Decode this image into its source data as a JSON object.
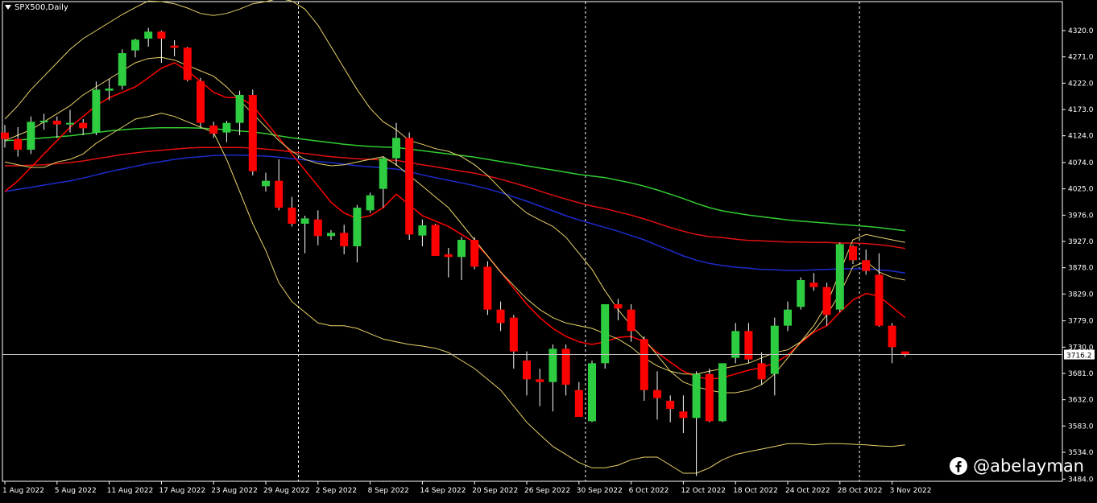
{
  "header": {
    "symbol": "SPX500,Daily"
  },
  "watermark": {
    "handle": "@abelayman",
    "icon": "facebook-icon"
  },
  "price_tag": "3716.2",
  "colors": {
    "background": "#000000",
    "bull": "#2ecc40",
    "bear": "#ff0000",
    "ma_fast": "#ff0000",
    "ma_slow_red": "#e01010",
    "ma_green": "#32cd32",
    "ma_blue": "#1c2ccc",
    "bollinger": "#e8d26a",
    "axis_text": "#ffffff",
    "price_line": "#c0c0c0"
  },
  "chart_data": {
    "type": "candlestick",
    "title": "SPX500,Daily",
    "y_ticks": [
      4320.0,
      4271.0,
      4222.0,
      4173.0,
      4124.0,
      4074.0,
      4025.0,
      3976.0,
      3927.0,
      3878.0,
      3829.0,
      3779.0,
      3730.0,
      3681.0,
      3632.0,
      3583.0,
      3534.0,
      3484.0
    ],
    "ylim": [
      3480,
      4374
    ],
    "x_tick_labels": [
      "1 Aug 2022",
      "5 Aug 2022",
      "11 Aug 2022",
      "17 Aug 2022",
      "23 Aug 2022",
      "29 Aug 2022",
      "2 Sep 2022",
      "8 Sep 2022",
      "14 Sep 2022",
      "20 Sep 2022",
      "26 Sep 2022",
      "30 Sep 2022",
      "6 Oct 2022",
      "12 Oct 2022",
      "18 Oct 2022",
      "24 Oct 2022",
      "28 Oct 2022",
      "3 Nov 2022"
    ],
    "x_tick_bar_index": [
      0,
      4,
      8,
      12,
      16,
      20,
      24,
      28,
      32,
      36,
      40,
      44,
      48,
      52,
      56,
      60,
      64,
      68
    ],
    "period_separators_bar_index": [
      22.5,
      44.5,
      65.5
    ],
    "last_price": 3716.2,
    "candles": [
      {
        "o": 4130,
        "h": 4144,
        "l": 4102,
        "c": 4118
      },
      {
        "o": 4118,
        "h": 4140,
        "l": 4085,
        "c": 4098
      },
      {
        "o": 4098,
        "h": 4160,
        "l": 4090,
        "c": 4150
      },
      {
        "o": 4150,
        "h": 4165,
        "l": 4135,
        "c": 4152
      },
      {
        "o": 4152,
        "h": 4160,
        "l": 4120,
        "c": 4145
      },
      {
        "o": 4145,
        "h": 4172,
        "l": 4130,
        "c": 4148
      },
      {
        "o": 4148,
        "h": 4155,
        "l": 4125,
        "c": 4138
      },
      {
        "o": 4130,
        "h": 4225,
        "l": 4125,
        "c": 4210
      },
      {
        "o": 4208,
        "h": 4230,
        "l": 4190,
        "c": 4212
      },
      {
        "o": 4217,
        "h": 4285,
        "l": 4210,
        "c": 4278
      },
      {
        "o": 4283,
        "h": 4305,
        "l": 4270,
        "c": 4303
      },
      {
        "o": 4305,
        "h": 4325,
        "l": 4290,
        "c": 4318
      },
      {
        "o": 4318,
        "h": 4320,
        "l": 4260,
        "c": 4305
      },
      {
        "o": 4292,
        "h": 4302,
        "l": 4272,
        "c": 4288
      },
      {
        "o": 4288,
        "h": 4290,
        "l": 4225,
        "c": 4228
      },
      {
        "o": 4226,
        "h": 4232,
        "l": 4140,
        "c": 4148
      },
      {
        "o": 4143,
        "h": 4150,
        "l": 4120,
        "c": 4128
      },
      {
        "o": 4130,
        "h": 4152,
        "l": 4112,
        "c": 4148
      },
      {
        "o": 4148,
        "h": 4208,
        "l": 4125,
        "c": 4200
      },
      {
        "o": 4200,
        "h": 4210,
        "l": 4050,
        "c": 4058
      },
      {
        "o": 4030,
        "h": 4055,
        "l": 4020,
        "c": 4040
      },
      {
        "o": 4040,
        "h": 4080,
        "l": 3985,
        "c": 3990
      },
      {
        "o": 3990,
        "h": 4010,
        "l": 3955,
        "c": 3960
      },
      {
        "o": 3960,
        "h": 3975,
        "l": 3905,
        "c": 3970
      },
      {
        "o": 3968,
        "h": 3985,
        "l": 3920,
        "c": 3937
      },
      {
        "o": 3937,
        "h": 3948,
        "l": 3930,
        "c": 3943
      },
      {
        "o": 3943,
        "h": 3958,
        "l": 3903,
        "c": 3918
      },
      {
        "o": 3918,
        "h": 3995,
        "l": 3888,
        "c": 3990
      },
      {
        "o": 3985,
        "h": 4018,
        "l": 3980,
        "c": 4013
      },
      {
        "o": 4025,
        "h": 4085,
        "l": 3990,
        "c": 4082
      },
      {
        "o": 4082,
        "h": 4148,
        "l": 4068,
        "c": 4120
      },
      {
        "o": 4120,
        "h": 4130,
        "l": 3930,
        "c": 3940
      },
      {
        "o": 3938,
        "h": 3968,
        "l": 3918,
        "c": 3957
      },
      {
        "o": 3958,
        "h": 3960,
        "l": 3905,
        "c": 3900
      },
      {
        "o": 3903,
        "h": 3915,
        "l": 3860,
        "c": 3898
      },
      {
        "o": 3898,
        "h": 3935,
        "l": 3855,
        "c": 3930
      },
      {
        "o": 3930,
        "h": 3935,
        "l": 3875,
        "c": 3880
      },
      {
        "o": 3880,
        "h": 3890,
        "l": 3790,
        "c": 3800
      },
      {
        "o": 3800,
        "h": 3815,
        "l": 3760,
        "c": 3775
      },
      {
        "o": 3785,
        "h": 3790,
        "l": 3690,
        "c": 3722
      },
      {
        "o": 3705,
        "h": 3722,
        "l": 3640,
        "c": 3670
      },
      {
        "o": 3670,
        "h": 3690,
        "l": 3620,
        "c": 3665
      },
      {
        "o": 3665,
        "h": 3735,
        "l": 3610,
        "c": 3727
      },
      {
        "o": 3727,
        "h": 3735,
        "l": 3640,
        "c": 3660
      },
      {
        "o": 3650,
        "h": 3665,
        "l": 3600,
        "c": 3600
      },
      {
        "o": 3592,
        "h": 3705,
        "l": 3590,
        "c": 3700
      },
      {
        "o": 3700,
        "h": 3810,
        "l": 3690,
        "c": 3810
      },
      {
        "o": 3810,
        "h": 3820,
        "l": 3780,
        "c": 3802
      },
      {
        "o": 3800,
        "h": 3810,
        "l": 3740,
        "c": 3760
      },
      {
        "o": 3745,
        "h": 3750,
        "l": 3630,
        "c": 3650
      },
      {
        "o": 3650,
        "h": 3685,
        "l": 3595,
        "c": 3635
      },
      {
        "o": 3630,
        "h": 3640,
        "l": 3590,
        "c": 3615
      },
      {
        "o": 3610,
        "h": 3640,
        "l": 3570,
        "c": 3598
      },
      {
        "o": 3598,
        "h": 3685,
        "l": 3490,
        "c": 3680
      },
      {
        "o": 3680,
        "h": 3690,
        "l": 3590,
        "c": 3592
      },
      {
        "o": 3592,
        "h": 3700,
        "l": 3590,
        "c": 3700
      },
      {
        "o": 3710,
        "h": 3775,
        "l": 3700,
        "c": 3760
      },
      {
        "o": 3760,
        "h": 3775,
        "l": 3700,
        "c": 3707
      },
      {
        "o": 3700,
        "h": 3720,
        "l": 3660,
        "c": 3670
      },
      {
        "o": 3680,
        "h": 3785,
        "l": 3640,
        "c": 3770
      },
      {
        "o": 3770,
        "h": 3815,
        "l": 3760,
        "c": 3800
      },
      {
        "o": 3805,
        "h": 3860,
        "l": 3800,
        "c": 3855
      },
      {
        "o": 3850,
        "h": 3868,
        "l": 3835,
        "c": 3842
      },
      {
        "o": 3842,
        "h": 3850,
        "l": 3770,
        "c": 3790
      },
      {
        "o": 3800,
        "h": 3925,
        "l": 3795,
        "c": 3922
      },
      {
        "o": 3918,
        "h": 3920,
        "l": 3885,
        "c": 3892
      },
      {
        "o": 3892,
        "h": 3912,
        "l": 3865,
        "c": 3872
      },
      {
        "o": 3865,
        "h": 3905,
        "l": 3768,
        "c": 3770
      },
      {
        "o": 3770,
        "h": 3775,
        "l": 3700,
        "c": 3730
      },
      {
        "o": 3722,
        "h": 3722,
        "l": 3712,
        "c": 3716
      }
    ],
    "moving_averages": [
      {
        "color": "#32cd32",
        "values": [
          4115,
          4116,
          4118,
          4120,
          4122,
          4124,
          4127,
          4130,
          4133,
          4135,
          4137,
          4138,
          4139,
          4139,
          4139,
          4138,
          4137,
          4135,
          4133,
          4131,
          4128,
          4124,
          4120,
          4117,
          4114,
          4111,
          4108,
          4106,
          4104,
          4103,
          4102,
          4099,
          4096,
          4093,
          4090,
          4087,
          4084,
          4080,
          4076,
          4072,
          4068,
          4064,
          4060,
          4056,
          4052,
          4049,
          4046,
          4041,
          4036,
          4030,
          4023,
          4015,
          4007,
          3998,
          3990,
          3984,
          3980,
          3976,
          3973,
          3970,
          3967,
          3965,
          3963,
          3961,
          3959,
          3957,
          3955,
          3953,
          3950,
          3947
        ]
      },
      {
        "color": "#e01010",
        "values": [
          4068,
          4068,
          4069,
          4070,
          4072,
          4074,
          4077,
          4081,
          4085,
          4089,
          4092,
          4095,
          4097,
          4099,
          4101,
          4102,
          4102,
          4102,
          4102,
          4101,
          4099,
          4097,
          4094,
          4091,
          4088,
          4085,
          4083,
          4081,
          4080,
          4079,
          4078,
          4074,
          4070,
          4066,
          4062,
          4058,
          4054,
          4049,
          4043,
          4036,
          4029,
          4021,
          4013,
          4006,
          3999,
          3993,
          3988,
          3982,
          3976,
          3969,
          3961,
          3953,
          3946,
          3940,
          3936,
          3934,
          3931,
          3929,
          3928,
          3927,
          3926,
          3926,
          3925,
          3925,
          3924,
          3924,
          3923,
          3921,
          3918,
          3914
        ]
      },
      {
        "color": "#1c2ccc",
        "values": [
          4020,
          4024,
          4028,
          4032,
          4036,
          4040,
          4045,
          4051,
          4057,
          4062,
          4067,
          4072,
          4076,
          4080,
          4083,
          4085,
          4087,
          4088,
          4088,
          4087,
          4086,
          4084,
          4081,
          4079,
          4076,
          4074,
          4071,
          4068,
          4066,
          4064,
          4062,
          4057,
          4051,
          4046,
          4041,
          4036,
          4031,
          4025,
          4018,
          4010,
          4002,
          3993,
          3984,
          3975,
          3967,
          3960,
          3953,
          3946,
          3938,
          3930,
          3920,
          3910,
          3900,
          3892,
          3886,
          3882,
          3879,
          3877,
          3875,
          3874,
          3873,
          3873,
          3874,
          3875,
          3876,
          3876,
          3876,
          3874,
          3872,
          3868
        ]
      },
      {
        "color": "#ff0000",
        "values": [
          4020,
          4040,
          4065,
          4090,
          4115,
          4140,
          4160,
          4180,
          4195,
          4205,
          4215,
          4232,
          4250,
          4260,
          4245,
          4225,
          4205,
          4195,
          4195,
          4180,
          4150,
          4120,
          4090,
          4060,
          4030,
          4000,
          3980,
          3970,
          3975,
          3990,
          4015,
          3995,
          3975,
          3965,
          3955,
          3940,
          3925,
          3900,
          3870,
          3840,
          3810,
          3785,
          3765,
          3750,
          3740,
          3735,
          3740,
          3748,
          3750,
          3740,
          3720,
          3702,
          3685,
          3675,
          3670,
          3673,
          3680,
          3687,
          3692,
          3700,
          3715,
          3738,
          3758,
          3770,
          3795,
          3818,
          3830,
          3825,
          3805,
          3785
        ]
      },
      {
        "color": "#e8d26a",
        "values": [
          4115,
          4125,
          4135,
          4150,
          4165,
          4180,
          4200,
          4215,
          4230,
          4245,
          4260,
          4268,
          4270,
          4265,
          4255,
          4245,
          4235,
          4215,
          4190,
          4165,
          4140,
          4115,
          4095,
          4080,
          4072,
          4068,
          4070,
          4075,
          4080,
          4085,
          4070,
          4050,
          4030,
          4010,
          3990,
          3960,
          3930,
          3900,
          3870,
          3845,
          3820,
          3800,
          3785,
          3775,
          3770,
          3765,
          3755,
          3745,
          3730,
          3710,
          3695,
          3685,
          3680,
          3680,
          3685,
          3690,
          3695,
          3700,
          3710,
          3720,
          3725,
          3740,
          3760,
          3790,
          3830,
          3880,
          3890,
          3870,
          3860,
          3855
        ]
      },
      {
        "color": "#e8d26a",
        "values": [
          4155,
          4180,
          4210,
          4235,
          4260,
          4285,
          4305,
          4320,
          4335,
          4350,
          4363,
          4375,
          4374,
          4370,
          4362,
          4352,
          4348,
          4352,
          4360,
          4370,
          4374,
          4380,
          4375,
          4360,
          4330,
          4290,
          4250,
          4210,
          4175,
          4150,
          4135,
          4115,
          4108,
          4100,
          4095,
          4085,
          4070,
          4050,
          4025,
          4000,
          3980,
          3967,
          3955,
          3935,
          3905,
          3875,
          3835,
          3800,
          3770,
          3745,
          3715,
          3685,
          3665,
          3656,
          3650,
          3645,
          3645,
          3650,
          3660,
          3680,
          3710,
          3740,
          3770,
          3810,
          3870,
          3930,
          3940,
          3935,
          3930,
          3925
        ]
      },
      {
        "color": "#e8d26a",
        "values": [
          4075,
          4070,
          4065,
          4065,
          4075,
          4080,
          4090,
          4110,
          4125,
          4140,
          4155,
          4160,
          4166,
          4160,
          4150,
          4140,
          4130,
          4080,
          4020,
          3960,
          3910,
          3850,
          3815,
          3795,
          3775,
          3770,
          3770,
          3765,
          3755,
          3745,
          3740,
          3735,
          3732,
          3728,
          3720,
          3705,
          3690,
          3670,
          3650,
          3620,
          3590,
          3567,
          3545,
          3530,
          3515,
          3505,
          3505,
          3510,
          3520,
          3525,
          3525,
          3510,
          3495,
          3495,
          3505,
          3520,
          3530,
          3535,
          3540,
          3545,
          3550,
          3550,
          3548,
          3550,
          3550,
          3549,
          3548,
          3546,
          3545,
          3548
        ]
      }
    ]
  }
}
